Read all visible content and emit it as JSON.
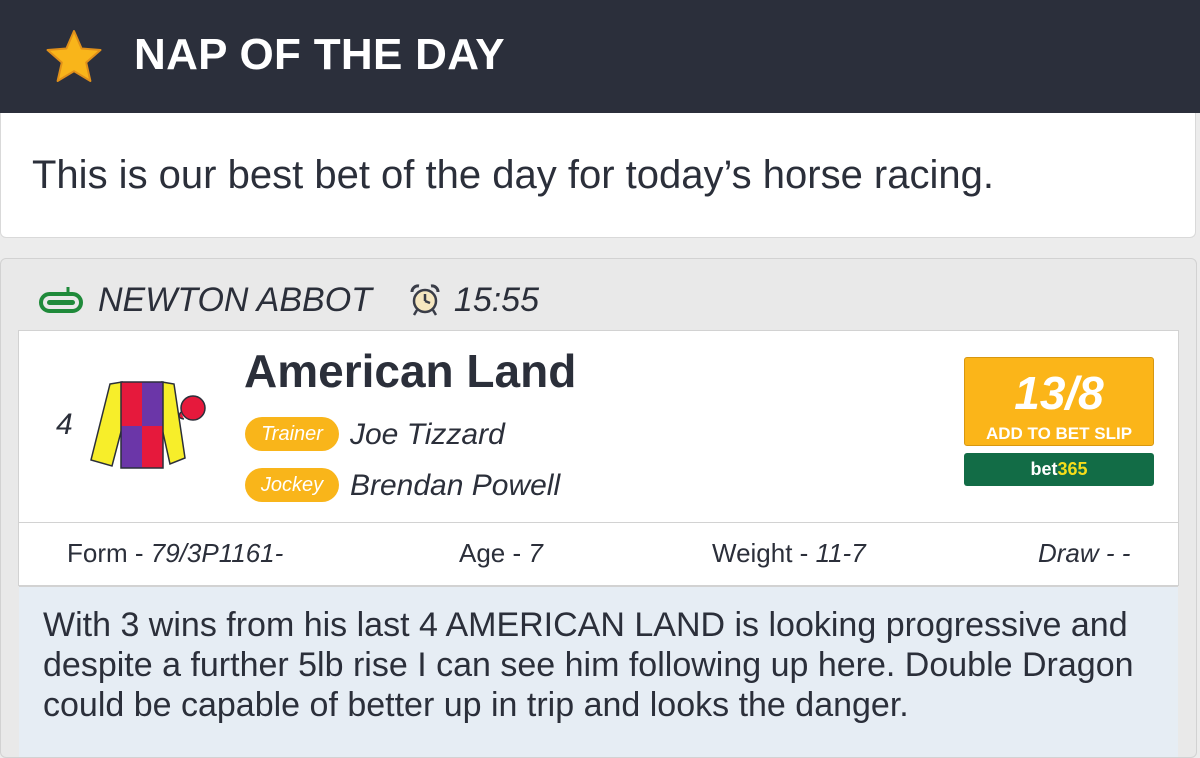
{
  "header": {
    "title": "NAP OF THE DAY",
    "icon": "star-icon",
    "colors": {
      "background": "#2b2f3b",
      "star": "#f9b51a"
    }
  },
  "intro": {
    "text": "This is our best bet of the day for today’s horse racing."
  },
  "race": {
    "course": "NEWTON ABBOT",
    "time": "15:55",
    "course_icon": "racetrack-icon",
    "time_icon": "alarm-clock-icon"
  },
  "runner": {
    "number": "4",
    "name": "American Land",
    "silks_icon": "jockey-silks-icon",
    "trainer_label": "Trainer",
    "trainer": "Joe Tizzard",
    "jockey_label": "Jockey",
    "jockey": "Brendan Powell",
    "odds": "13/8",
    "add_to_slip_label": "ADD TO BET SLIP",
    "bookmaker_part1": "bet",
    "bookmaker_part2": "365",
    "stats": {
      "form_label": "Form - ",
      "form": "79/3P1161-",
      "age_label": "Age - ",
      "age": "7",
      "weight_label": "Weight - ",
      "weight": "11-7",
      "draw_label": "Draw - ",
      "draw": "-"
    },
    "comment": "With 3 wins from his last 4 AMERICAN LAND is looking progressive and despite a further 5lb rise I can see him following up here. Double Dragon could be capable of better up in trip and looks the danger.",
    "colors": {
      "pill": "#f9b51a",
      "odds_button": "#fbb519",
      "bookmaker": "#126c46"
    }
  }
}
